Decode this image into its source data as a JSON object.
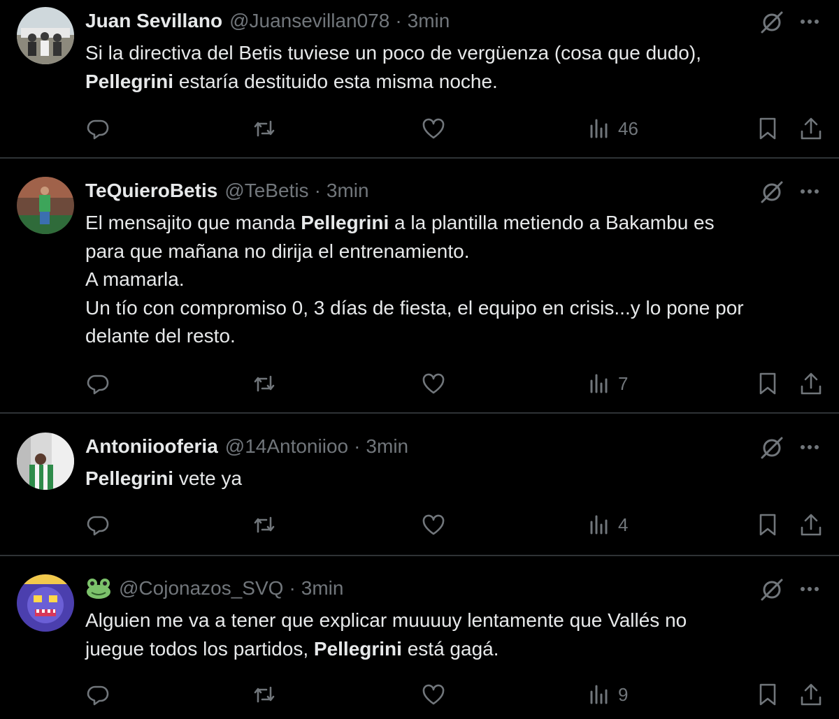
{
  "colors": {
    "background": "#000000",
    "text": "#e7e9ea",
    "muted": "#71767b",
    "divider": "#2f3336"
  },
  "tweets": [
    {
      "display_name": "Juan Sevillano",
      "handle": "@Juansevillan078",
      "separator": "·",
      "time": "3min",
      "text": {
        "l1": "Si la directiva del Betis tuviese un poco de vergüenza (cosa que dudo),",
        "l2_bold": "Pellegrini",
        "l2_rest": " estaría destituido esta misma noche."
      },
      "views": "46"
    },
    {
      "display_name": "TeQuieroBetis",
      "handle": "@TeBetis",
      "separator": "·",
      "time": "3min",
      "text": {
        "l1_pre": "El mensajito que manda ",
        "l1_bold": "Pellegrini",
        "l1_post": " a la plantilla metiendo a Bakambu es",
        "l2": "para que mañana no dirija el entrenamiento.",
        "l3": "A mamarla.",
        "l4": "Un tío con compromiso 0, 3 días de fiesta, el equipo en crisis...y lo pone por",
        "l5": "delante del resto."
      },
      "views": "7"
    },
    {
      "display_name": "Antoniiooferia",
      "handle": "@14Antoniioo",
      "separator": "·",
      "time": "3min",
      "text": {
        "l1_bold": "Pellegrini",
        "l1_rest": " vete ya"
      },
      "views": "4"
    },
    {
      "display_name_icon": "frog-emoji-icon",
      "handle": "@Cojonazos_SVQ",
      "separator": "·",
      "time": "3min",
      "text": {
        "l1": "Alguien me va a tener que explicar muuuuy lentamente que Vallés no",
        "l2_pre": "juegue todos los partidos, ",
        "l2_bold": "Pellegrini",
        "l2_post": " está gagá."
      },
      "views": "9"
    }
  ],
  "icons": {
    "reply": "reply-icon",
    "retweet": "retweet-icon",
    "like": "heart-icon",
    "views": "analytics-icon",
    "bookmark": "bookmark-icon",
    "share": "share-icon",
    "grok": "grok-icon",
    "more": "more-icon"
  }
}
